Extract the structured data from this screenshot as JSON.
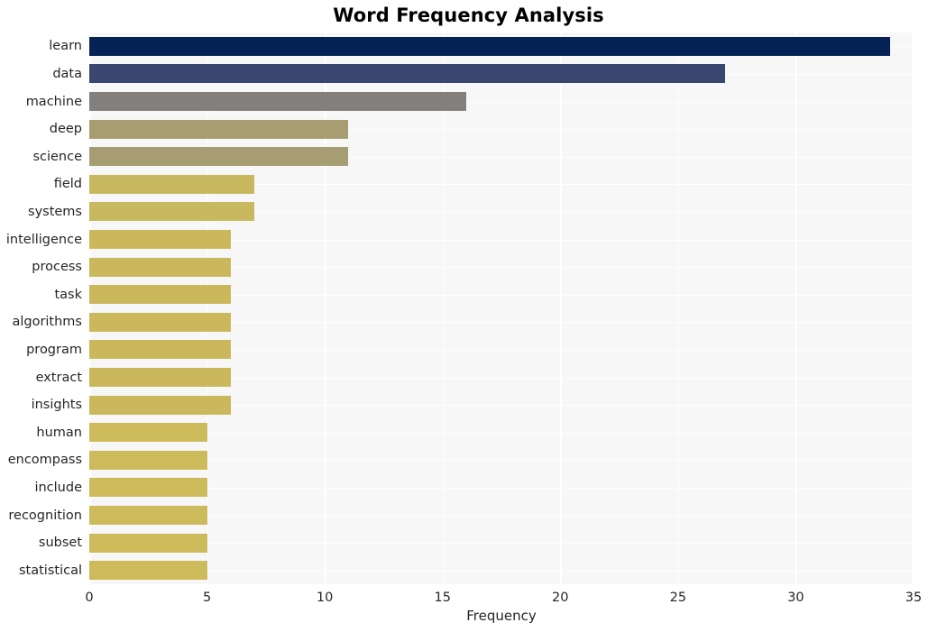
{
  "chart_data": {
    "type": "bar",
    "orientation": "horizontal",
    "title": "Word Frequency Analysis",
    "xlabel": "Frequency",
    "ylabel": "",
    "xlim": [
      0,
      35
    ],
    "xticks": [
      0,
      5,
      10,
      15,
      20,
      25,
      30,
      35
    ],
    "grid": true,
    "legend": null,
    "categories": [
      "learn",
      "data",
      "machine",
      "deep",
      "science",
      "field",
      "systems",
      "intelligence",
      "process",
      "task",
      "algorithms",
      "program",
      "extract",
      "insights",
      "human",
      "encompass",
      "include",
      "recognition",
      "subset",
      "statistical"
    ],
    "values": [
      34,
      27,
      16,
      11,
      11,
      7,
      7,
      6,
      6,
      6,
      6,
      6,
      6,
      6,
      5,
      5,
      5,
      5,
      5,
      5
    ],
    "bar_colors": [
      "#042354",
      "#3a4670",
      "#837f7c",
      "#a89d71",
      "#a79d72",
      "#c8b85f",
      "#c8b85f",
      "#cbb85c",
      "#cbb85c",
      "#cbb85c",
      "#cbb85c",
      "#cbb85c",
      "#cbb85c",
      "#cbb85c",
      "#cdba5b",
      "#cdba5b",
      "#cdba5b",
      "#cdba5b",
      "#cdba5b",
      "#cdba5b"
    ]
  },
  "style": {
    "figure_background": "#ffffff",
    "axes_background": "#f7f7f7",
    "grid_color": "#ffffff",
    "text_color": "#262626",
    "title_color": "#000000"
  }
}
